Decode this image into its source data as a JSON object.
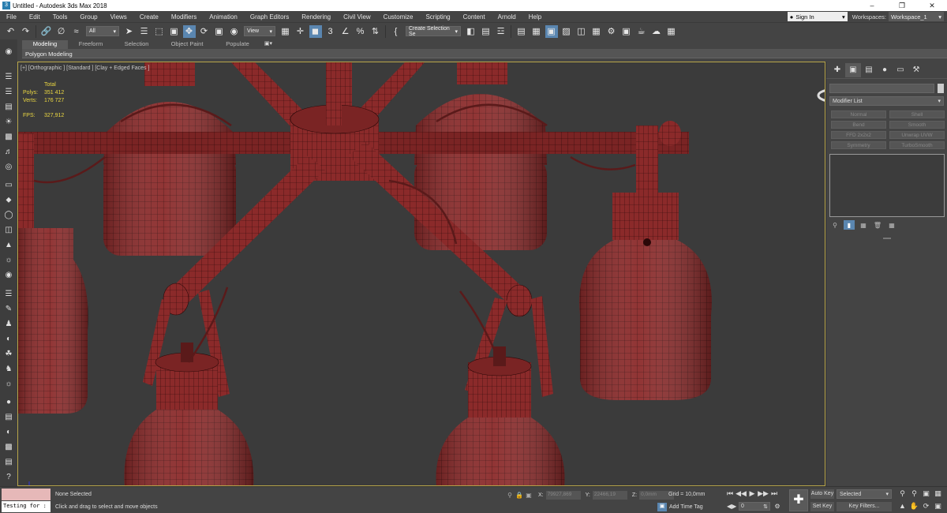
{
  "window": {
    "title": "Untitled - Autodesk 3ds Max 2018",
    "app_icon": "3"
  },
  "menus": [
    "File",
    "Edit",
    "Tools",
    "Group",
    "Views",
    "Create",
    "Modifiers",
    "Animation",
    "Graph Editors",
    "Rendering",
    "Civil View",
    "Customize",
    "Scripting",
    "Content",
    "Arnold",
    "Help"
  ],
  "account": {
    "sign_in": "Sign In"
  },
  "workspaces": {
    "label": "Workspaces:",
    "value": "Workspace_1"
  },
  "toolbar": {
    "filter": "All",
    "ref_coord": "View",
    "snap_label": "3",
    "create_selection": "Create Selection Se"
  },
  "ribbon": {
    "tabs": [
      "Modeling",
      "Freeform",
      "Selection",
      "Object Paint",
      "Populate"
    ],
    "active_tab": "Modeling",
    "sub_label": "Polygon Modeling"
  },
  "viewport": {
    "label": "[+] [Orthographic ] [Standard ] [Clay + Edged Faces ]",
    "stats": {
      "total_label": "Total",
      "polys_label": "Polys:",
      "polys_value": "351 412",
      "verts_label": "Verts:",
      "verts_value": "176 727",
      "fps_label": "FPS:",
      "fps_value": "327,912"
    },
    "model_color": "#8b2a2a",
    "wire_color": "#2a0808",
    "background_color": "#3b3b3b",
    "active_border": "#b8a64a"
  },
  "command_panel": {
    "modifier_list": "Modifier List",
    "modifier_buttons": [
      "Normal",
      "Shell",
      "Bend",
      "Smooth",
      "FFD 2x2x2",
      "Unwrap UVW",
      "Symmetry",
      "TurboSmooth"
    ]
  },
  "status": {
    "selection": "None Selected",
    "prompt": "Click and drag to select and move objects",
    "script_input": "Testing for :",
    "x_label": "X:",
    "x_value": "79927,869",
    "y_label": "Y:",
    "y_value": "22466,19",
    "z_label": "Z:",
    "z_value": "0,0mm",
    "grid": "Grid = 10,0mm",
    "add_time_tag": "Add Time Tag",
    "auto_key": "Auto Key",
    "set_key": "Set Key",
    "selected": "Selected",
    "key_filters": "Key Filters...",
    "frame": "0"
  }
}
